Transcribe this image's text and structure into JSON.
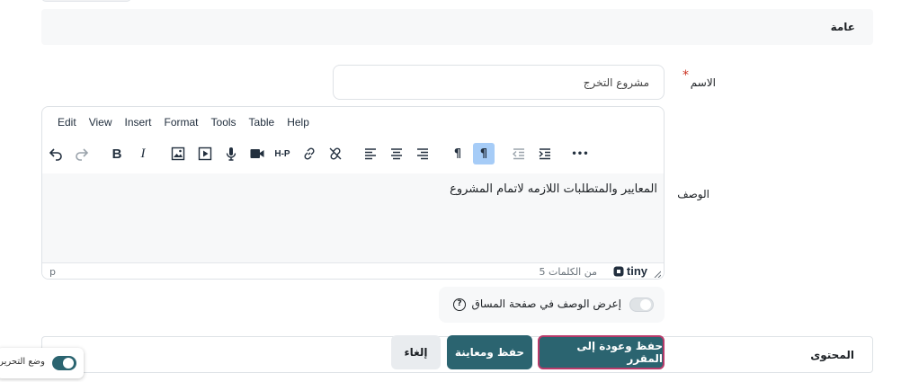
{
  "sections": {
    "general_title": "عامة",
    "content_title": "المحتوى"
  },
  "name_field": {
    "label": "الاسم",
    "required_marker": "*",
    "value": "مشروع التخرج"
  },
  "description_field": {
    "label": "الوصف"
  },
  "editor": {
    "menu": [
      "Edit",
      "View",
      "Insert",
      "Format",
      "Tools",
      "Table",
      "Help"
    ],
    "content": "المعايير والمتطلبات اللازمه لاتمام المشروع",
    "status_path": "p",
    "word_count": "من الكلمات 5",
    "brand": "tiny",
    "toolbar_icons": [
      "undo-icon",
      "redo-icon",
      "bold-icon",
      "italic-icon",
      "image-icon",
      "media-icon",
      "microphone-icon",
      "video-camera-icon",
      "h5p-icon",
      "link-icon",
      "unlink-icon",
      "align-left-icon",
      "align-center-icon",
      "align-right-icon",
      "ltr-icon",
      "rtl-icon",
      "outdent-icon",
      "indent-icon",
      "more-icon"
    ],
    "h5p_label": "H-P",
    "bold_label": "B",
    "italic_label": "I",
    "more_label": "•••"
  },
  "show_description": {
    "label": "إعرض الوصف في صفحة المساق",
    "enabled": false
  },
  "buttons": {
    "save_return": "حفظ وعودة إلى المقرر",
    "save_preview": "حفظ ومعاينة",
    "cancel": "إلغاء"
  },
  "edit_mode": {
    "label": "وضع التحرير",
    "enabled": true
  },
  "colors": {
    "primary": "#2b6470",
    "focus_border": "#b83a6a",
    "required": "#ca3120",
    "active_toolbar": "#a6ccf7"
  }
}
